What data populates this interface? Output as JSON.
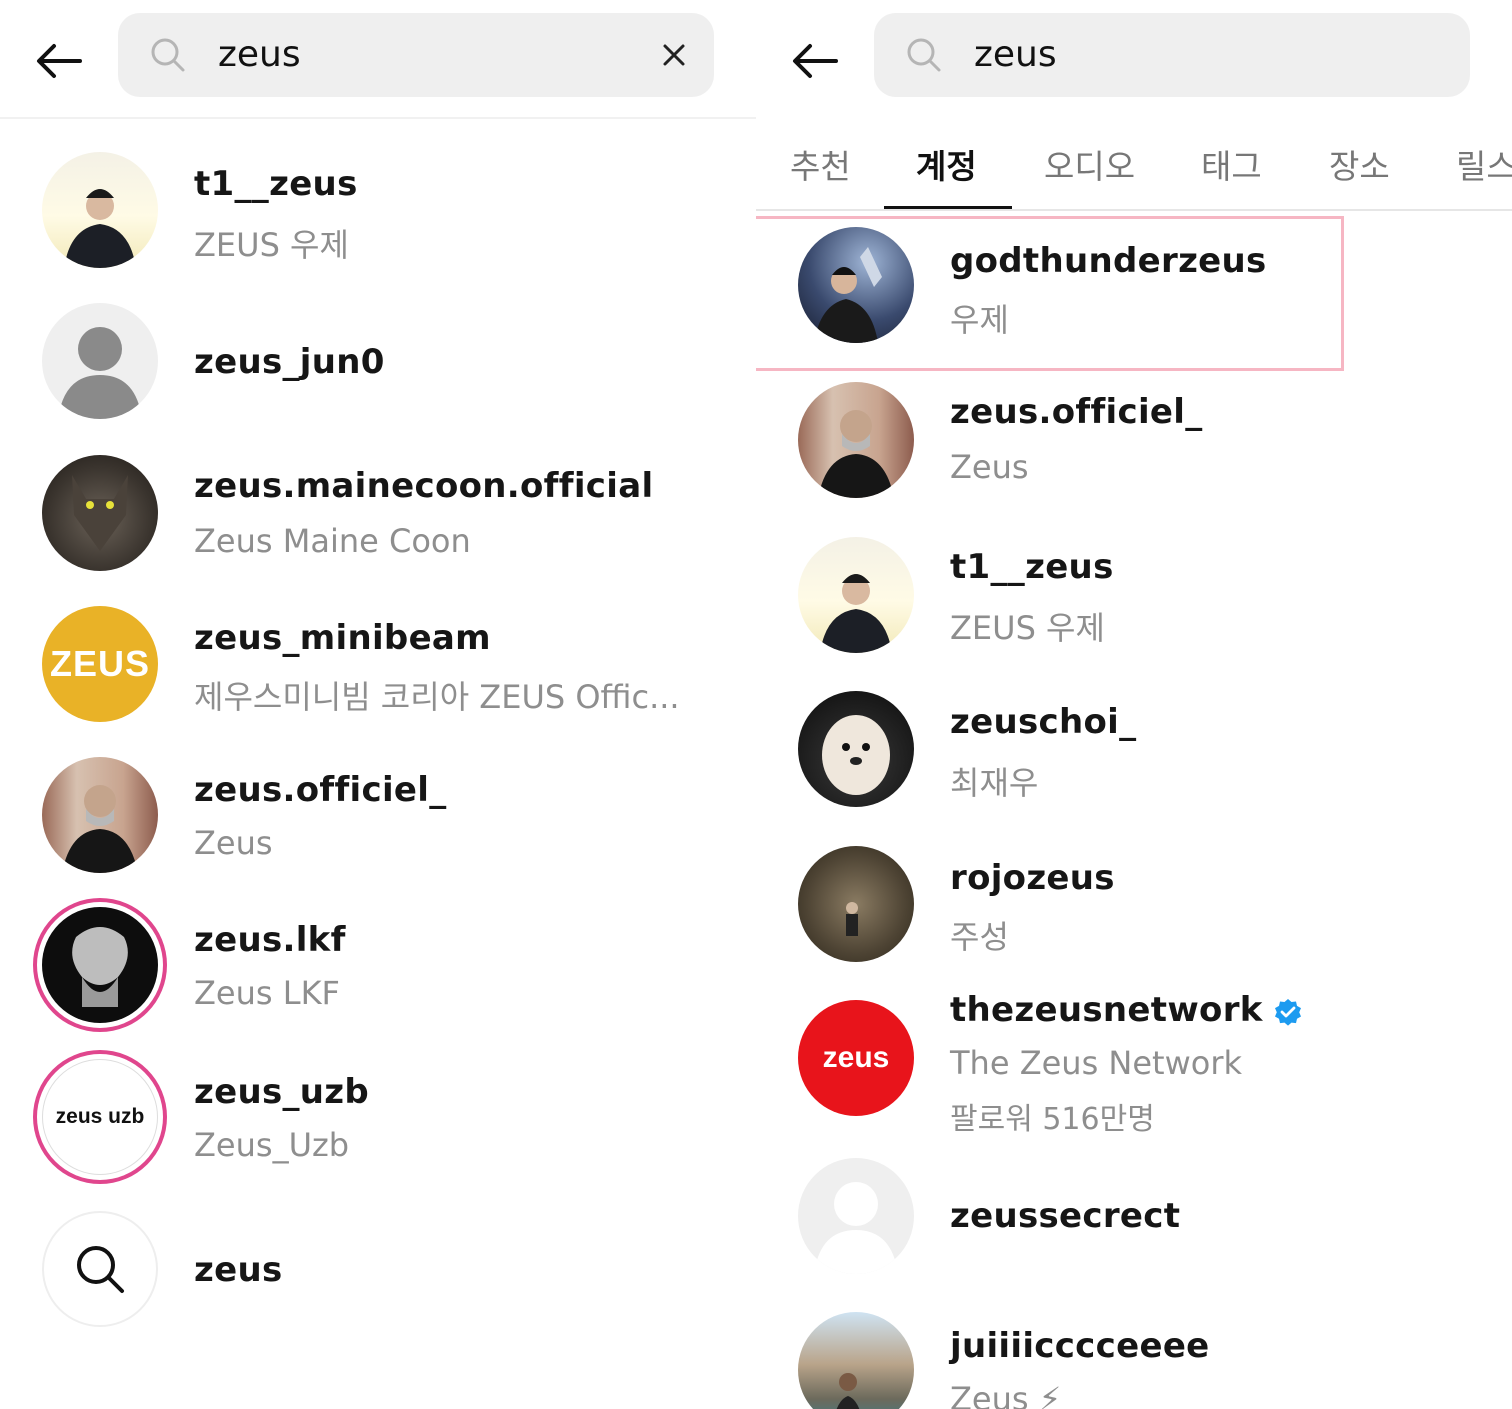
{
  "left": {
    "search": {
      "query": "zeus"
    },
    "results": [
      {
        "username": "t1__zeus",
        "name": "ZEUS 우제"
      },
      {
        "username": "zeus_jun0",
        "name": ""
      },
      {
        "username": "zeus.mainecoon.official",
        "name": "Zeus Maine Coon"
      },
      {
        "username": "zeus_minibeam",
        "name": "제우스미니빔 코리아 ZEUS Offic...",
        "avatar_text": "ZEUS"
      },
      {
        "username": "zeus.officiel_",
        "name": "Zeus"
      },
      {
        "username": "zeus.lkf",
        "name": "Zeus LKF"
      },
      {
        "username": "zeus_uzb",
        "name": "Zeus_Uzb",
        "avatar_text": "zeus uzb"
      },
      {
        "username": "zeus",
        "name": ""
      }
    ]
  },
  "right": {
    "search": {
      "query": "zeus"
    },
    "tabs": [
      "추천",
      "계정",
      "오디오",
      "태그",
      "장소",
      "릴스"
    ],
    "active_tab": "계정",
    "results": [
      {
        "username": "godthunderzeus",
        "name": "우제"
      },
      {
        "username": "zeus.officiel_",
        "name": "Zeus"
      },
      {
        "username": "t1__zeus",
        "name": "ZEUS 우제"
      },
      {
        "username": "zeuschoi_",
        "name": "최재우"
      },
      {
        "username": "rojozeus",
        "name": "주성"
      },
      {
        "username": "thezeusnetwork",
        "name": "The Zeus Network",
        "followers": "팔로워 516만명",
        "avatar_text": "zeus"
      },
      {
        "username": "zeussecrect",
        "name": ""
      },
      {
        "username": "juiiiicccceeee",
        "name": "Zeus ⚡"
      }
    ]
  },
  "colors": {
    "highlight": "#f6b6c3",
    "verified": "#1d9bf0",
    "story_ring": "#e0468d",
    "zeus_network_red": "#e8141b",
    "minibeam_yellow": "#e9b227"
  }
}
